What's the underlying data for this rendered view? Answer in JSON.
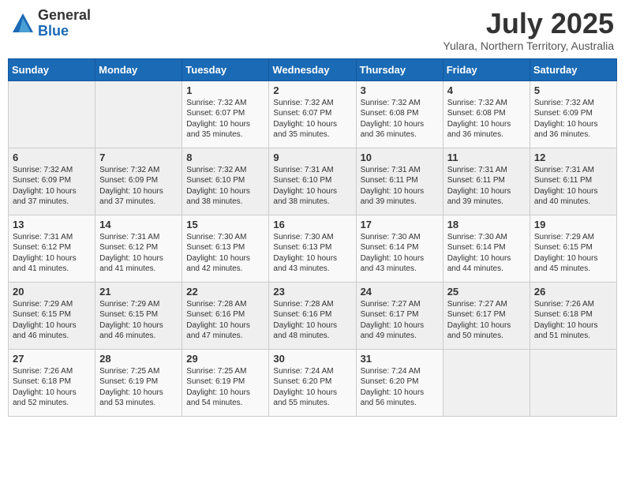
{
  "header": {
    "logo_general": "General",
    "logo_blue": "Blue",
    "month_title": "July 2025",
    "subtitle": "Yulara, Northern Territory, Australia"
  },
  "days_of_week": [
    "Sunday",
    "Monday",
    "Tuesday",
    "Wednesday",
    "Thursday",
    "Friday",
    "Saturday"
  ],
  "weeks": [
    [
      {
        "day": "",
        "content": ""
      },
      {
        "day": "",
        "content": ""
      },
      {
        "day": "1",
        "content": "Sunrise: 7:32 AM\nSunset: 6:07 PM\nDaylight: 10 hours and 35 minutes."
      },
      {
        "day": "2",
        "content": "Sunrise: 7:32 AM\nSunset: 6:07 PM\nDaylight: 10 hours and 35 minutes."
      },
      {
        "day": "3",
        "content": "Sunrise: 7:32 AM\nSunset: 6:08 PM\nDaylight: 10 hours and 36 minutes."
      },
      {
        "day": "4",
        "content": "Sunrise: 7:32 AM\nSunset: 6:08 PM\nDaylight: 10 hours and 36 minutes."
      },
      {
        "day": "5",
        "content": "Sunrise: 7:32 AM\nSunset: 6:09 PM\nDaylight: 10 hours and 36 minutes."
      }
    ],
    [
      {
        "day": "6",
        "content": "Sunrise: 7:32 AM\nSunset: 6:09 PM\nDaylight: 10 hours and 37 minutes."
      },
      {
        "day": "7",
        "content": "Sunrise: 7:32 AM\nSunset: 6:09 PM\nDaylight: 10 hours and 37 minutes."
      },
      {
        "day": "8",
        "content": "Sunrise: 7:32 AM\nSunset: 6:10 PM\nDaylight: 10 hours and 38 minutes."
      },
      {
        "day": "9",
        "content": "Sunrise: 7:31 AM\nSunset: 6:10 PM\nDaylight: 10 hours and 38 minutes."
      },
      {
        "day": "10",
        "content": "Sunrise: 7:31 AM\nSunset: 6:11 PM\nDaylight: 10 hours and 39 minutes."
      },
      {
        "day": "11",
        "content": "Sunrise: 7:31 AM\nSunset: 6:11 PM\nDaylight: 10 hours and 39 minutes."
      },
      {
        "day": "12",
        "content": "Sunrise: 7:31 AM\nSunset: 6:11 PM\nDaylight: 10 hours and 40 minutes."
      }
    ],
    [
      {
        "day": "13",
        "content": "Sunrise: 7:31 AM\nSunset: 6:12 PM\nDaylight: 10 hours and 41 minutes."
      },
      {
        "day": "14",
        "content": "Sunrise: 7:31 AM\nSunset: 6:12 PM\nDaylight: 10 hours and 41 minutes."
      },
      {
        "day": "15",
        "content": "Sunrise: 7:30 AM\nSunset: 6:13 PM\nDaylight: 10 hours and 42 minutes."
      },
      {
        "day": "16",
        "content": "Sunrise: 7:30 AM\nSunset: 6:13 PM\nDaylight: 10 hours and 43 minutes."
      },
      {
        "day": "17",
        "content": "Sunrise: 7:30 AM\nSunset: 6:14 PM\nDaylight: 10 hours and 43 minutes."
      },
      {
        "day": "18",
        "content": "Sunrise: 7:30 AM\nSunset: 6:14 PM\nDaylight: 10 hours and 44 minutes."
      },
      {
        "day": "19",
        "content": "Sunrise: 7:29 AM\nSunset: 6:15 PM\nDaylight: 10 hours and 45 minutes."
      }
    ],
    [
      {
        "day": "20",
        "content": "Sunrise: 7:29 AM\nSunset: 6:15 PM\nDaylight: 10 hours and 46 minutes."
      },
      {
        "day": "21",
        "content": "Sunrise: 7:29 AM\nSunset: 6:15 PM\nDaylight: 10 hours and 46 minutes."
      },
      {
        "day": "22",
        "content": "Sunrise: 7:28 AM\nSunset: 6:16 PM\nDaylight: 10 hours and 47 minutes."
      },
      {
        "day": "23",
        "content": "Sunrise: 7:28 AM\nSunset: 6:16 PM\nDaylight: 10 hours and 48 minutes."
      },
      {
        "day": "24",
        "content": "Sunrise: 7:27 AM\nSunset: 6:17 PM\nDaylight: 10 hours and 49 minutes."
      },
      {
        "day": "25",
        "content": "Sunrise: 7:27 AM\nSunset: 6:17 PM\nDaylight: 10 hours and 50 minutes."
      },
      {
        "day": "26",
        "content": "Sunrise: 7:26 AM\nSunset: 6:18 PM\nDaylight: 10 hours and 51 minutes."
      }
    ],
    [
      {
        "day": "27",
        "content": "Sunrise: 7:26 AM\nSunset: 6:18 PM\nDaylight: 10 hours and 52 minutes."
      },
      {
        "day": "28",
        "content": "Sunrise: 7:25 AM\nSunset: 6:19 PM\nDaylight: 10 hours and 53 minutes."
      },
      {
        "day": "29",
        "content": "Sunrise: 7:25 AM\nSunset: 6:19 PM\nDaylight: 10 hours and 54 minutes."
      },
      {
        "day": "30",
        "content": "Sunrise: 7:24 AM\nSunset: 6:20 PM\nDaylight: 10 hours and 55 minutes."
      },
      {
        "day": "31",
        "content": "Sunrise: 7:24 AM\nSunset: 6:20 PM\nDaylight: 10 hours and 56 minutes."
      },
      {
        "day": "",
        "content": ""
      },
      {
        "day": "",
        "content": ""
      }
    ]
  ]
}
